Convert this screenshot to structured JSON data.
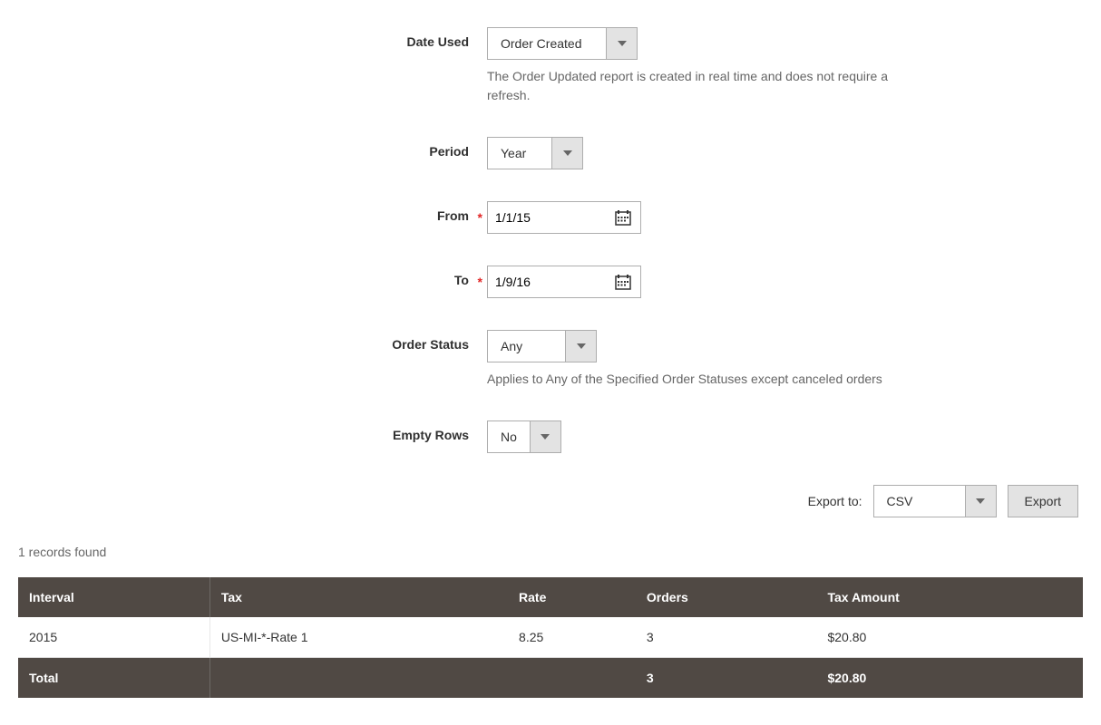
{
  "filters": {
    "dateUsed": {
      "label": "Date Used",
      "value": "Order Created",
      "help": "The Order Updated report is created in real time and does not require a refresh."
    },
    "period": {
      "label": "Period",
      "value": "Year"
    },
    "from": {
      "label": "From",
      "value": "1/1/15"
    },
    "to": {
      "label": "To",
      "value": "1/9/16"
    },
    "orderStatus": {
      "label": "Order Status",
      "value": "Any",
      "help": "Applies to Any of the Specified Order Statuses except canceled orders"
    },
    "emptyRows": {
      "label": "Empty Rows",
      "value": "No"
    }
  },
  "export": {
    "label": "Export to:",
    "format": "CSV",
    "buttonLabel": "Export"
  },
  "recordsFound": "1 records found",
  "table": {
    "headers": {
      "interval": "Interval",
      "tax": "Tax",
      "rate": "Rate",
      "orders": "Orders",
      "taxAmount": "Tax Amount"
    },
    "rows": [
      {
        "interval": "2015",
        "tax": "US-MI-*-Rate 1",
        "rate": "8.25",
        "orders": "3",
        "taxAmount": "$20.80"
      }
    ],
    "total": {
      "label": "Total",
      "orders": "3",
      "taxAmount": "$20.80"
    }
  }
}
